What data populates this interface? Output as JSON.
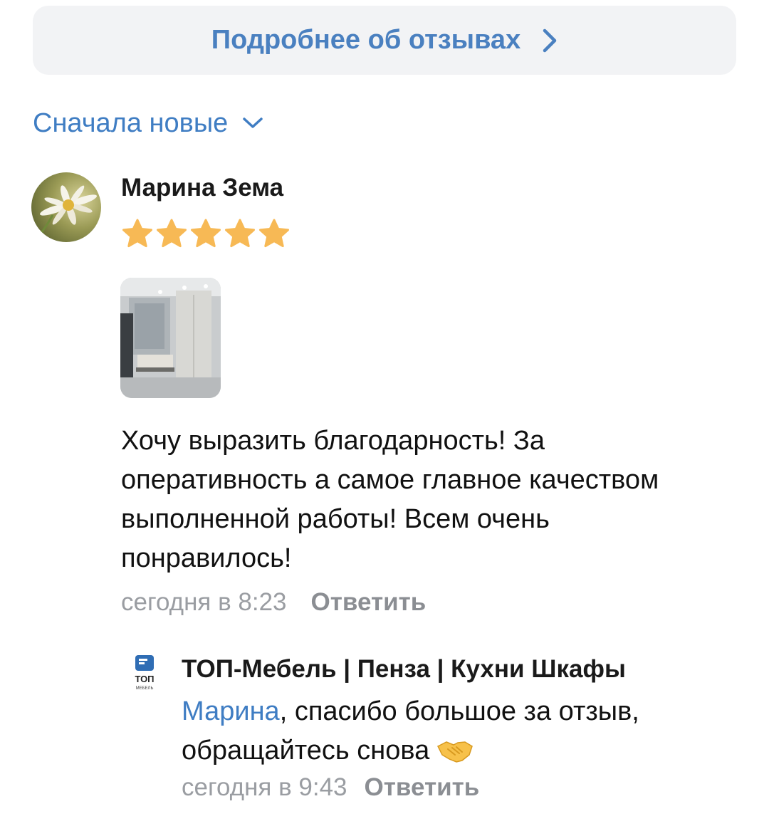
{
  "more_reviews": {
    "label": "Подробнее об отзывах",
    "icon": "chevron-right-icon"
  },
  "sort": {
    "label": "Сначала новые",
    "icon": "chevron-down-icon"
  },
  "review": {
    "author": "Марина Зема",
    "rating": 5,
    "rating_max": 5,
    "text": "Хочу выразить благодарность! За оперативность а самое главное качеством выполненной работы! Всем очень понравилось!",
    "date": "сегодня в 8:23",
    "reply_label": "Ответить"
  },
  "reply": {
    "author": "ТОП-Мебель | Пенза | Кухни Шкафы",
    "logo_text": "ТОП",
    "logo_subtext": "МЕБЕЛЬ",
    "mention": "Марина",
    "text": ", спасибо большое за отзыв, обращайтесь снова",
    "emoji": "handshake-icon",
    "date": "сегодня в 9:43",
    "reply_label": "Ответить"
  },
  "colors": {
    "accent": "#3f7dc3",
    "star": "#f7b955",
    "button_bg": "#f2f3f5",
    "muted": "#9a9da2"
  }
}
